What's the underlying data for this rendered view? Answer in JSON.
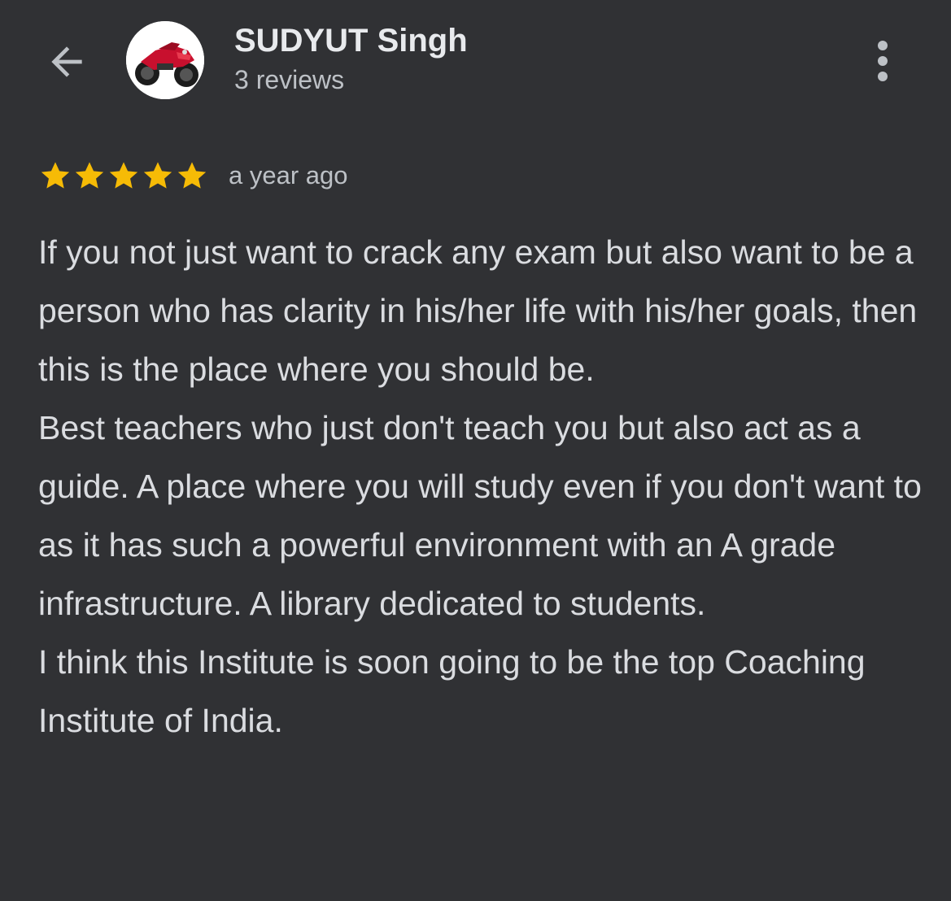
{
  "header": {
    "back_icon": "arrow-back-icon",
    "avatar_icon": "motorcycle-avatar",
    "name": "SUDYUT Singh",
    "review_count": "3 reviews",
    "more_icon": "more-vert-icon"
  },
  "review": {
    "rating": 5,
    "rating_max": 5,
    "star_color": "#f6bb06",
    "time": "a year ago",
    "paragraphs": [
      "If you not just want to crack any exam but also want to be a person who has clarity in his/her life with his/her goals, then this is the place where you should be.",
      "Best teachers who just don't teach you but also act as a guide. A place where you will study even if you don't want to as it has such a powerful environment with an A grade infrastructure. A library dedicated to students.",
      "I think this Institute is soon going to be the top Coaching Institute of India."
    ]
  },
  "colors": {
    "background": "#303134",
    "text_primary": "#e8eaed",
    "text_secondary": "#bdc1c6"
  }
}
